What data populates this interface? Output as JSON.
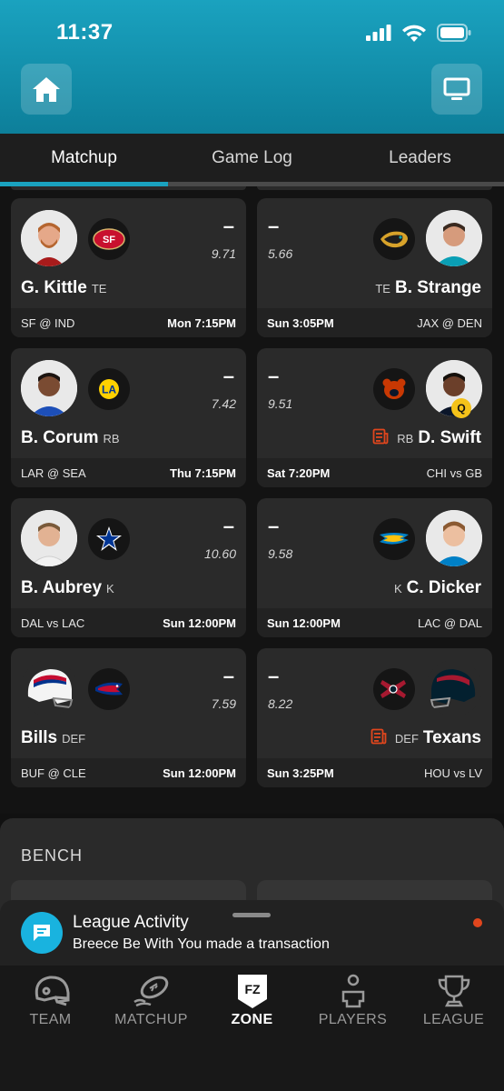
{
  "status": {
    "time": "11:37"
  },
  "tabs": [
    {
      "label": "Matchup"
    },
    {
      "label": "Game Log"
    },
    {
      "label": "Leaders"
    }
  ],
  "cards": [
    {
      "name": "G. Kittle",
      "pos": "TE",
      "score": "–",
      "proj": "9.71",
      "matchup": "SF @ IND",
      "time": "Mon 7:15PM",
      "logo": "49ers-logo-icon"
    },
    {
      "name": "B. Strange",
      "pos": "TE",
      "score": "–",
      "proj": "5.66",
      "matchup": "JAX @ DEN",
      "time": "Sun 3:05PM",
      "logo": "jaguars-logo-icon"
    },
    {
      "name": "B. Corum",
      "pos": "RB",
      "score": "–",
      "proj": "7.42",
      "matchup": "LAR @ SEA",
      "time": "Thu 7:15PM",
      "logo": "rams-logo-icon"
    },
    {
      "name": "D. Swift",
      "pos": "RB",
      "score": "–",
      "proj": "9.51",
      "matchup": "CHI vs GB",
      "time": "Sat 7:20PM",
      "logo": "bears-logo-icon",
      "badge": "Q"
    },
    {
      "name": "B. Aubrey",
      "pos": "K",
      "score": "–",
      "proj": "10.60",
      "matchup": "DAL vs LAC",
      "time": "Sun 12:00PM",
      "logo": "cowboys-logo-icon"
    },
    {
      "name": "C. Dicker",
      "pos": "K",
      "score": "–",
      "proj": "9.58",
      "matchup": "LAC @ DAL",
      "time": "Sun 12:00PM",
      "logo": "chargers-logo-icon"
    },
    {
      "name": "Bills",
      "pos": "DEF",
      "score": "–",
      "proj": "7.59",
      "matchup": "BUF @ CLE",
      "time": "Sun 12:00PM",
      "logo": "bills-logo-icon"
    },
    {
      "name": "Texans",
      "pos": "DEF",
      "score": "–",
      "proj": "8.22",
      "matchup": "HOU vs LV",
      "time": "Sun 3:25PM",
      "logo": "texans-logo-icon"
    }
  ],
  "bench": {
    "title": "BENCH"
  },
  "activity": {
    "title": "League Activity",
    "message": "Breece Be With You made a transaction"
  },
  "nav": [
    {
      "label": "TEAM",
      "icon": "helmet-icon"
    },
    {
      "label": "MATCHUP",
      "icon": "football-icon"
    },
    {
      "label": "ZONE",
      "icon": "fz-shield-icon",
      "glyph": "FZ"
    },
    {
      "label": "PLAYERS",
      "icon": "player-icon"
    },
    {
      "label": "LEAGUE",
      "icon": "trophy-icon"
    }
  ],
  "colors": {
    "accent": "#1aa2bf",
    "card": "#2a2a2a",
    "alert": "#e1461d",
    "questionable": "#f4c21a"
  }
}
